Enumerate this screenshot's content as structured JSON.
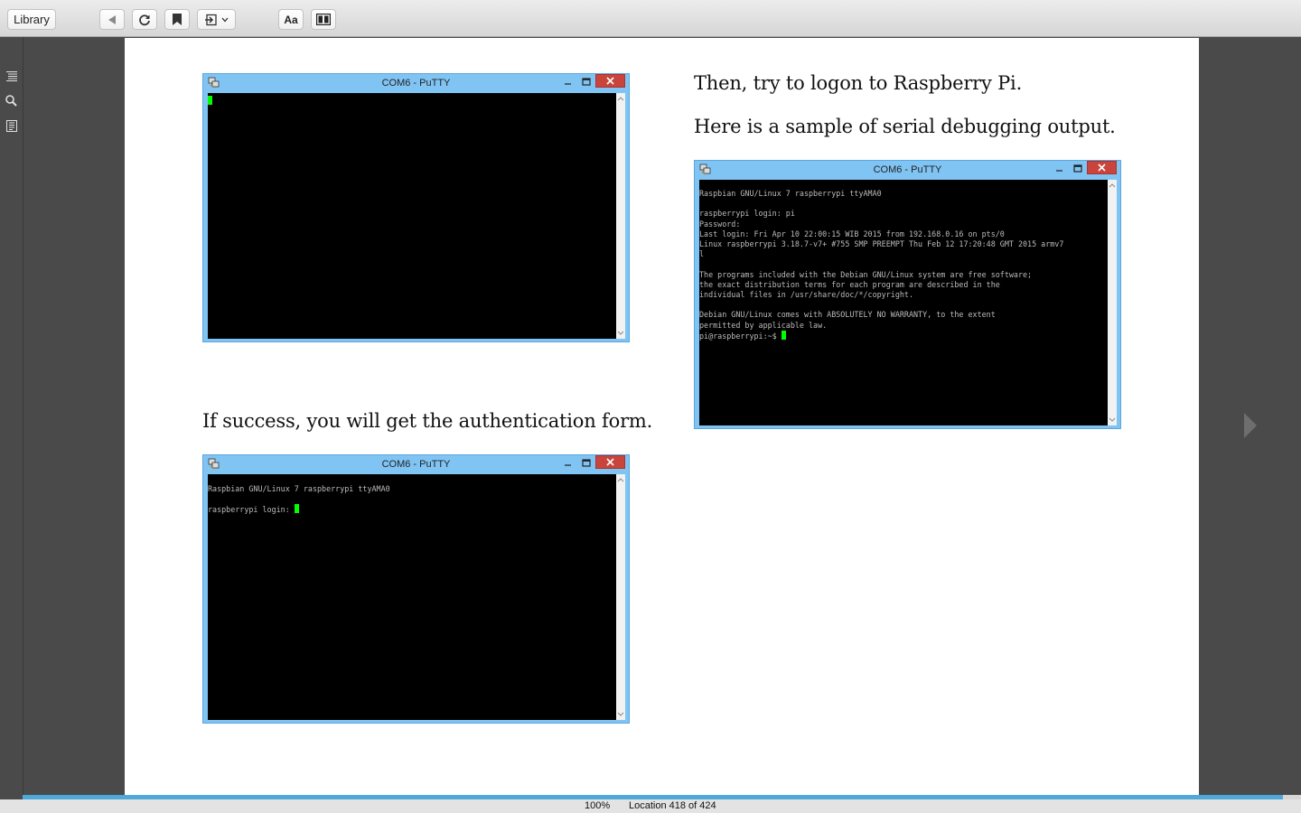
{
  "toolbar": {
    "library_label": "Library",
    "font_label": "Aa",
    "icons": [
      "back-icon",
      "refresh-icon",
      "bookmark-icon",
      "goto-icon",
      "chevron-down-icon",
      "layout-icon"
    ]
  },
  "sidebar": {
    "icons": [
      "toc-icon",
      "search-icon",
      "notes-icon"
    ]
  },
  "page": {
    "para_top_right_1": "Then, try to logon to Raspberry Pi.",
    "para_top_right_2": "Here is a sample of serial debugging output.",
    "para_left": "If success, you will get the authentication form."
  },
  "putty_windows": [
    {
      "title": "COM6 - PuTTY",
      "text": ""
    },
    {
      "title": "COM6 - PuTTY",
      "text": "Raspbian GNU/Linux 7 raspberrypi ttyAMA0\n\nraspberrypi login: pi\nPassword:\nLast login: Fri Apr 10 22:00:15 WIB 2015 from 192.168.0.16 on pts/0\nLinux raspberrypi 3.18.7-v7+ #755 SMP PREEMPT Thu Feb 12 17:20:48 GMT 2015 armv7\nl\n\nThe programs included with the Debian GNU/Linux system are free software;\nthe exact distribution terms for each program are described in the\nindividual files in /usr/share/doc/*/copyright.\n\nDebian GNU/Linux comes with ABSOLUTELY NO WARRANTY, to the extent\npermitted by applicable law.\npi@raspberrypi:~$ "
    },
    {
      "title": "COM6 - PuTTY",
      "text": "Raspbian GNU/Linux 7 raspberrypi ttyAMA0\n\nraspberrypi login: "
    }
  ],
  "status": {
    "zoom": "100%",
    "location": "Location 418 of 424",
    "progress": 0.986
  },
  "colors": {
    "accent": "#4ea9da",
    "putty_frame": "#80c4f4",
    "cursor": "#00ff00"
  }
}
